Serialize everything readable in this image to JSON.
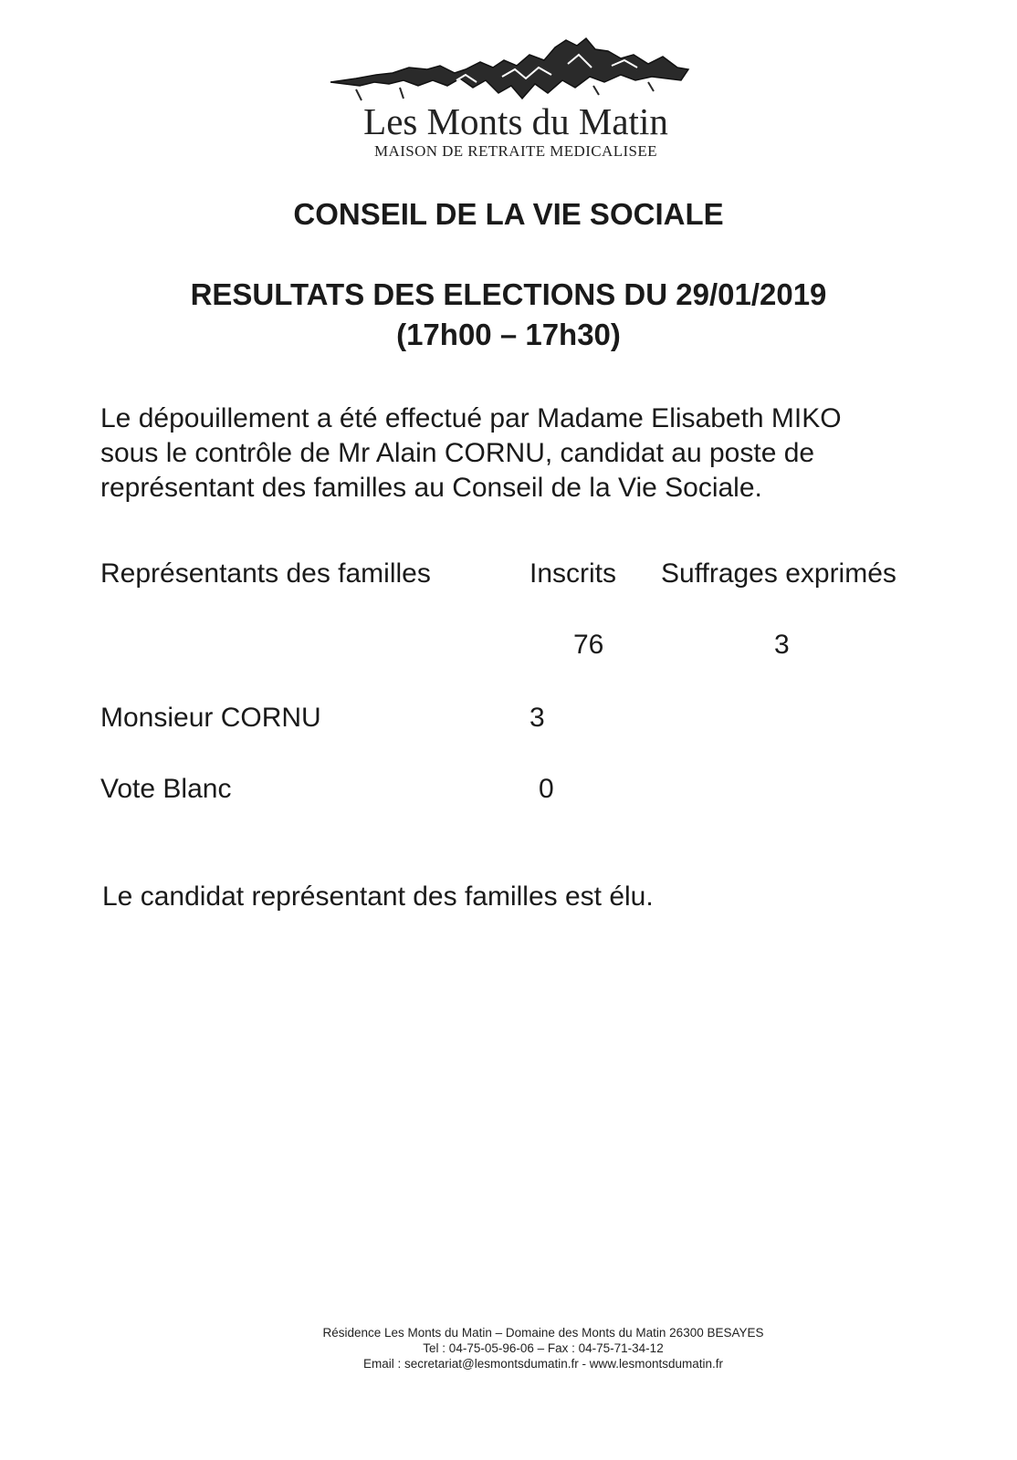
{
  "header": {
    "org_name": "Les Monts du Matin",
    "org_subtitle": "MAISON DE RETRAITE MEDICALISEE"
  },
  "titles": {
    "council": "CONSEIL DE LA VIE SOCIALE",
    "results": "RESULTATS DES ELECTIONS DU 29/01/2019",
    "hours": "(17h00 – 17h30)"
  },
  "intro": {
    "line1": "Le dépouillement a été effectué par Madame Elisabeth MIKO",
    "line2": "sous le contrôle de Mr Alain CORNU, candidat au poste de",
    "line3": "représentant des familles au Conseil de la Vie Sociale."
  },
  "results_table": {
    "headers": {
      "group": "Représentants des familles",
      "registered": "Inscrits",
      "cast": "Suffrages exprimés"
    },
    "totals": {
      "registered": "76",
      "cast": "3"
    },
    "rows": [
      {
        "label": "Monsieur CORNU",
        "votes": "3"
      },
      {
        "label": "Vote Blanc",
        "votes": "0"
      }
    ]
  },
  "conclusion": "Le candidat représentant des familles est élu.",
  "footer": {
    "line1": "Résidence Les Monts du Matin – Domaine des Monts du Matin 26300 BESAYES",
    "line2": "Tel : 04-75-05-96-06 – Fax : 04-75-71-34-12",
    "line3": "Email :  secretariat@lesmontsdumatin.fr -  www.lesmontsdumatin.fr"
  }
}
